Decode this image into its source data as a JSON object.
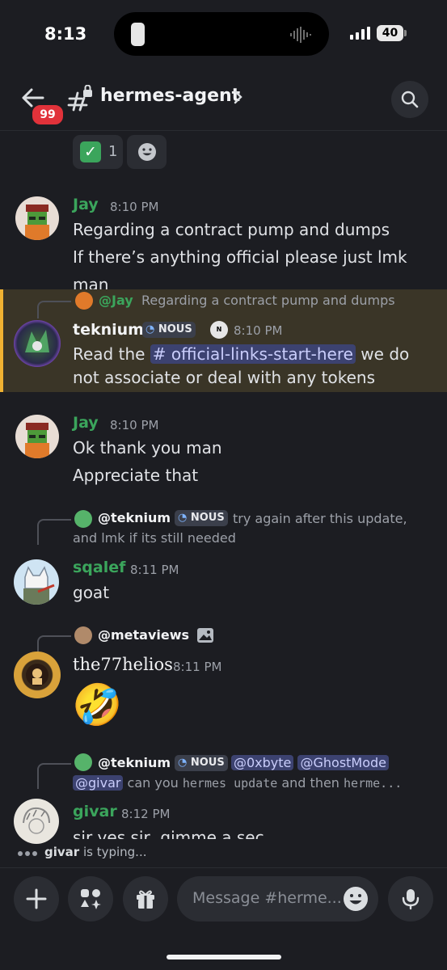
{
  "status_bar": {
    "time": "8:13",
    "battery": "40"
  },
  "header": {
    "channel": "hermes-agent",
    "unread_badge": "99"
  },
  "reactions": {
    "check_count": "1"
  },
  "messages": [
    {
      "author": "Jay",
      "time": "8:10 PM",
      "lines": [
        "Regarding a contract pump and dumps",
        "If there’s anything official please just lmk man"
      ]
    },
    {
      "reply": {
        "author": "@Jay",
        "text": "Regarding a contract pump and dumps"
      },
      "author": "teknium",
      "tag": "NOUS",
      "time": "8:10 PM",
      "text_before": "Read the ",
      "channel_mention": "# official-links-start-here",
      "text_after": " we do",
      "line2": "not associate or deal with any tokens"
    },
    {
      "author": "Jay",
      "time": "8:10 PM",
      "lines": [
        "Ok thank you man",
        "Appreciate that"
      ]
    },
    {
      "reply": {
        "author": "@teknium",
        "tag": "NOUS",
        "text": "try again after this update,",
        "text2": "and lmk if its still needed"
      },
      "author": "sqalef",
      "time": "8:11 PM",
      "lines": [
        "goat"
      ]
    },
    {
      "reply": {
        "author": "@metaviews"
      },
      "author": "the77helios",
      "time": "8:11 PM",
      "emoji": "🤣"
    },
    {
      "reply": {
        "author": "@teknium",
        "tag": "NOUS",
        "mention1": "@0xbyte",
        "mention2": "@GhostMode",
        "mention3": "@givar",
        "text": " can you ",
        "code1": "hermes update",
        "text2": " and then ",
        "code2": "herme..."
      },
      "author": "givar",
      "time": "8:12 PM",
      "lines": [
        "sir yes sir, gimme a sec"
      ]
    }
  ],
  "typing": {
    "user": "givar",
    "text": " is typing..."
  },
  "composer": {
    "placeholder": "Message #herme..."
  },
  "colors": {
    "background": "#1c1d22",
    "username_green": "#3ba55c",
    "highlight": "#3a3527",
    "highlight_bar": "#f0b232"
  }
}
